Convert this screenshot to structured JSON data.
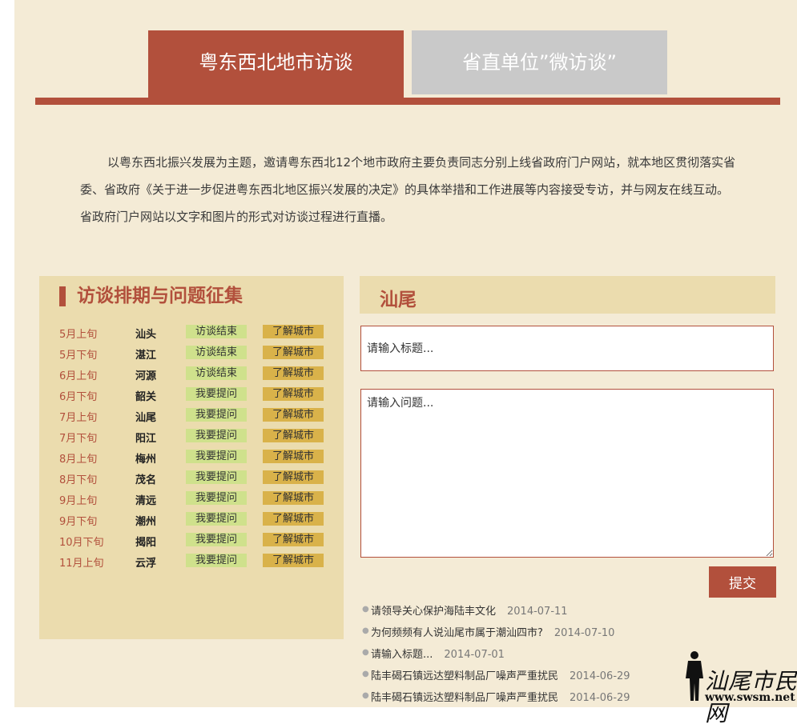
{
  "tabs": {
    "active": "粤东西北地市访谈",
    "inactive": "省直单位”微访谈”"
  },
  "intro": "以粤东西北振兴发展为主题，邀请粤东西北12个地市政府主要负责同志分别上线省政府门户网站，就本地区贯彻落实省委、省政府《关于进一步促进粤东西北地区振兴发展的决定》的具体举措和工作进展等内容接受专访，并与网友在线互动。省政府门户网站以文字和图片的形式对访谈过程进行直播。",
  "schedule": {
    "title": "访谈排期与问题征集",
    "rows": [
      {
        "date": "5月上旬",
        "city": "汕头",
        "status": "访谈结束",
        "learn": "了解城市"
      },
      {
        "date": "5月下旬",
        "city": "湛江",
        "status": "访谈结束",
        "learn": "了解城市"
      },
      {
        "date": "6月上旬",
        "city": "河源",
        "status": "访谈结束",
        "learn": "了解城市"
      },
      {
        "date": "6月下旬",
        "city": "韶关",
        "status": "我要提问",
        "learn": "了解城市"
      },
      {
        "date": "7月上旬",
        "city": "汕尾",
        "status": "我要提问",
        "learn": "了解城市"
      },
      {
        "date": "7月下旬",
        "city": "阳江",
        "status": "我要提问",
        "learn": "了解城市"
      },
      {
        "date": "8月上旬",
        "city": "梅州",
        "status": "我要提问",
        "learn": "了解城市"
      },
      {
        "date": "8月下旬",
        "city": "茂名",
        "status": "我要提问",
        "learn": "了解城市"
      },
      {
        "date": "9月上旬",
        "city": "清远",
        "status": "我要提问",
        "learn": "了解城市"
      },
      {
        "date": "9月下旬",
        "city": "潮州",
        "status": "我要提问",
        "learn": "了解城市"
      },
      {
        "date": "10月下旬",
        "city": "揭阳",
        "status": "我要提问",
        "learn": "了解城市"
      },
      {
        "date": "11月上旬",
        "city": "云浮",
        "status": "我要提问",
        "learn": "了解城市"
      }
    ]
  },
  "question": {
    "city": "汕尾",
    "title_placeholder": "请输入标题...",
    "body_placeholder": "请输入问题...",
    "submit": "提交"
  },
  "news": [
    {
      "title": "请领导关心保护海陆丰文化",
      "date": "2014-07-11"
    },
    {
      "title": "为何频频有人说汕尾市属于潮汕四市?",
      "date": "2014-07-10"
    },
    {
      "title": "请输入标题...",
      "date": "2014-07-01"
    },
    {
      "title": "陆丰碣石镇远达塑料制品厂噪声严重扰民",
      "date": "2014-06-29"
    },
    {
      "title": "陆丰碣石镇远达塑料制品厂噪声严重扰民",
      "date": "2014-06-29"
    }
  ],
  "watermark": {
    "text": "汕尾市民网",
    "url": "www.swsm.net"
  },
  "colors": {
    "accent": "#b2503c",
    "background": "#f4ebd6",
    "panel": "#ebdcae",
    "status_green": "#cfe18c",
    "learn_gold": "#d9b24a",
    "tab_inactive": "#c9c9c9"
  }
}
